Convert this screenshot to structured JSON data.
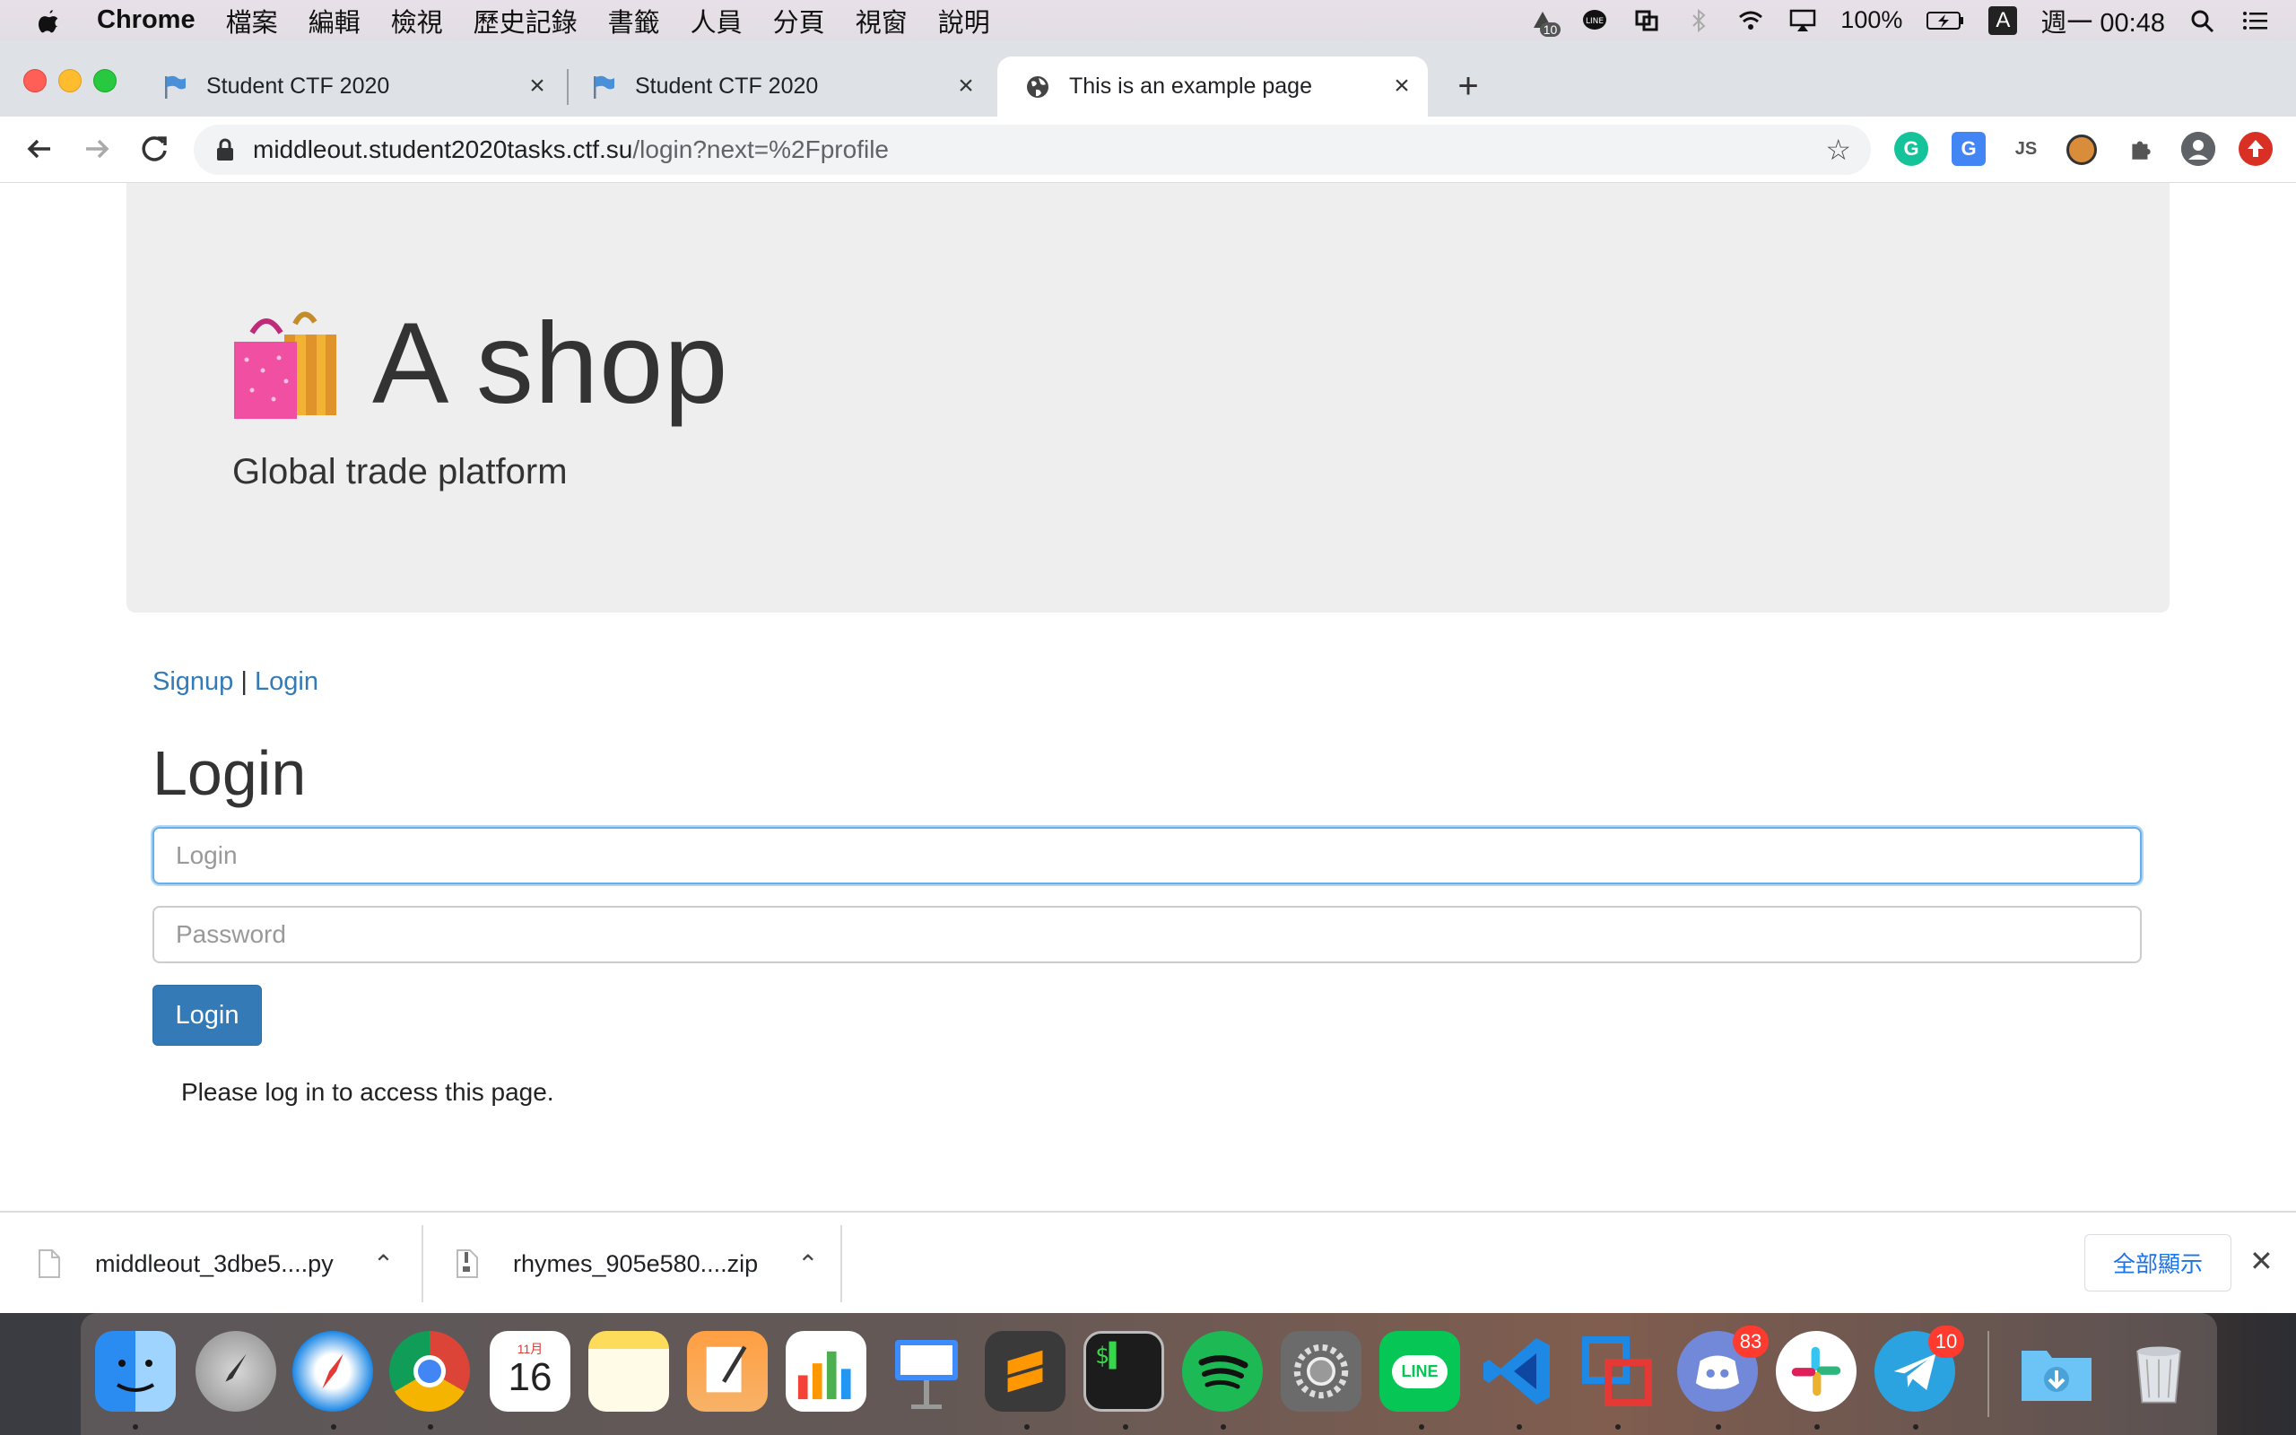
{
  "menubar": {
    "app_name": "Chrome",
    "items": [
      "檔案",
      "編輯",
      "檢視",
      "歷史記錄",
      "書籤",
      "人員",
      "分頁",
      "視窗",
      "說明"
    ],
    "battery": "100%",
    "input_source": "A",
    "clock": "週一 00:48",
    "notification_count": "10"
  },
  "tabs": [
    {
      "title": "Student CTF 2020",
      "active": false,
      "icon": "flag-icon"
    },
    {
      "title": "Student CTF 2020",
      "active": false,
      "icon": "flag-icon"
    },
    {
      "title": "This is an example page",
      "active": true,
      "icon": "globe-icon"
    }
  ],
  "omnibox": {
    "host": "middleout.student2020tasks.ctf.su",
    "path": "/login?next=%2Fprofile"
  },
  "page": {
    "site_title": "A shop",
    "tagline": "Global trade platform",
    "nav": {
      "signup": "Signup",
      "separator": "|",
      "login": "Login"
    },
    "heading": "Login",
    "login_placeholder": "Login",
    "password_placeholder": "Password",
    "submit_label": "Login",
    "flash_message": "Please log in to access this page."
  },
  "downloads": [
    {
      "name": "middleout_3dbe5....py",
      "icon": "file-icon"
    },
    {
      "name": "rhymes_905e580....zip",
      "icon": "zip-file-icon"
    }
  ],
  "downloads_show_all": "全部顯示",
  "dock": {
    "calendar_month": "11月",
    "calendar_day": "16",
    "badges": {
      "discord": "83",
      "telegram": "10"
    },
    "line_label": "LINE"
  },
  "colors": {
    "link": "#337ab7",
    "button": "#337ab7",
    "jumbotron": "#eeeeee",
    "focus_ring": "#66afe9"
  }
}
